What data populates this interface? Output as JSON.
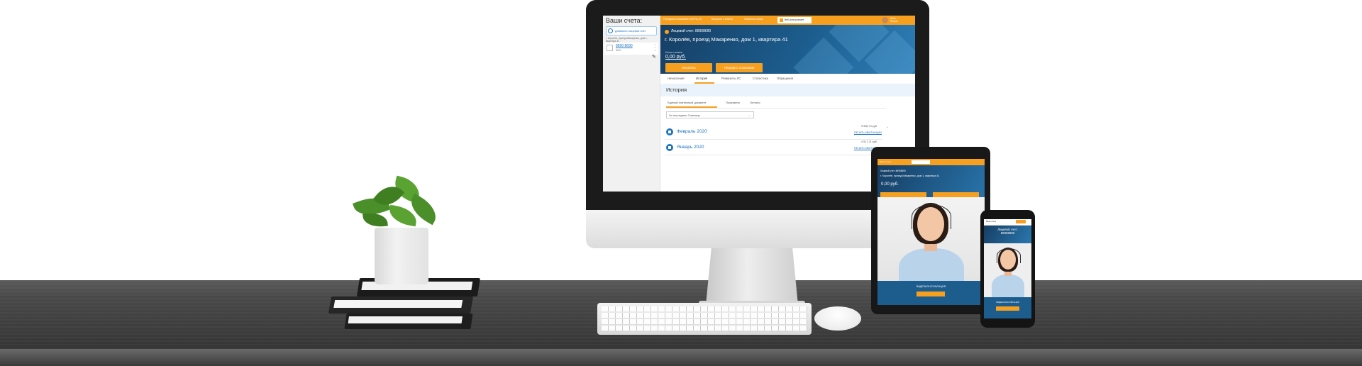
{
  "desktop": {
    "sidebar": {
      "title": "Ваши счета:",
      "add_button": "Добавить лицевой счёт",
      "account_address": "г. Королёв, проезд Макаренко, дом 1, квартира 41",
      "account_number": "8690 8690",
      "account_type": "ЖКХ"
    },
    "topbar": {
      "links": [
        "Передача показаний в ЕИРЦ ЛС",
        "Вопросы и ответы",
        "Обратная связь"
      ],
      "button": "Веб-консультант",
      "user": [
        "Иван",
        "Петров"
      ]
    },
    "banner": {
      "account": "Лицевой счет: 86908690",
      "address": "г. Королёв, проезд Макаренко, дом 1, квартира 41",
      "balance_label": "Итого к оплате",
      "amount": "0,00 руб.",
      "pay_button": "Оплатить",
      "meters_button": "Передать показания"
    },
    "tabs": [
      "Начисления",
      "История",
      "Реквизиты ЛС",
      "Статистика",
      "Обращения"
    ],
    "history": {
      "title": "История",
      "subtabs": [
        "Единый платежный документ",
        "Показания",
        "Оплаты"
      ],
      "period": "За последние 3 месяца",
      "rows": [
        {
          "month": "Февраль 2020",
          "sum": "3 908,74 руб.",
          "print": "ПЕЧАТЬ КВИТАНЦИИ"
        },
        {
          "month": "Январь 2020",
          "sum": "4 517,21 руб.",
          "print": "ПЕЧАТЬ КВИТАНЦИИ"
        }
      ]
    }
  },
  "tablet": {
    "top_link": "Ваши счета",
    "account": "Лицевой счет: 86908690",
    "address": "г. Королёв, проезд Макаренко, дом 1, квартира 41",
    "amount": "0,00 руб.",
    "footer": "ВИДЕОКОНСУЛЬТАЦИЯ"
  },
  "phone": {
    "top_link": "Ваши счета",
    "account_label": "Лицевой счет:",
    "account_number": "86908690",
    "footer": "ВИДЕОКОНСУЛЬТАЦИЯ"
  },
  "colors": {
    "accent": "#f7a01f",
    "brand_blue": "#1c5d8e",
    "link": "#1e73be"
  }
}
